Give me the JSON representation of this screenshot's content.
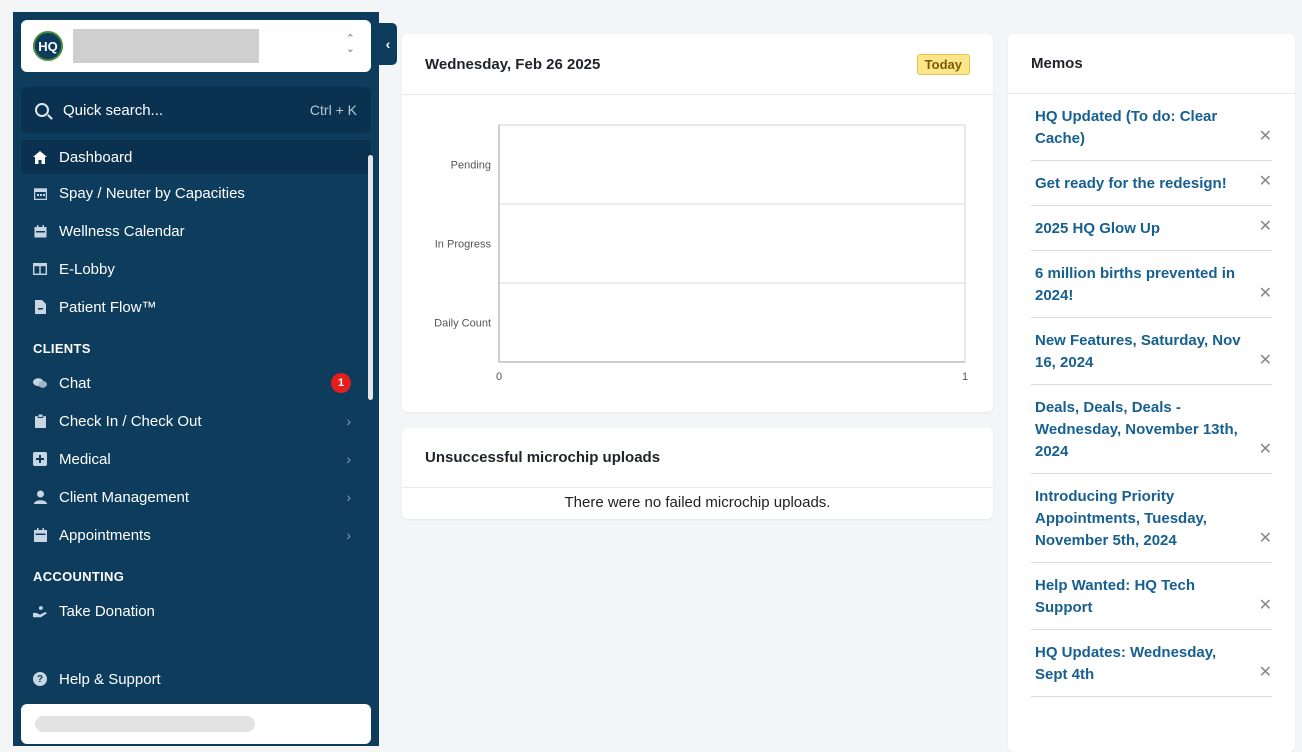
{
  "sidebar": {
    "logo_text": "HQ",
    "search_label": "Quick search...",
    "search_shortcut": "Ctrl + K",
    "items": [
      {
        "label": "Dashboard",
        "icon": "home-icon",
        "active": true
      },
      {
        "label": "Spay / Neuter by Capacities",
        "icon": "calendar-grid-icon"
      },
      {
        "label": "Wellness Calendar",
        "icon": "calendar-icon"
      },
      {
        "label": "E-Lobby",
        "icon": "columns-icon"
      },
      {
        "label": "Patient Flow™",
        "icon": "file-icon"
      }
    ],
    "clients_heading": "CLIENTS",
    "client_items": [
      {
        "label": "Chat",
        "icon": "chat-icon",
        "badge": "1"
      },
      {
        "label": "Check In / Check Out",
        "icon": "clipboard-icon"
      },
      {
        "label": "Medical",
        "icon": "medical-icon"
      },
      {
        "label": "Client Management",
        "icon": "user-icon"
      },
      {
        "label": "Appointments",
        "icon": "calendar-check-icon"
      }
    ],
    "accounting_heading": "ACCOUNTING",
    "accounting_items": [
      {
        "label": "Take Donation",
        "icon": "donation-hand-icon"
      }
    ],
    "help_label": "Help & Support"
  },
  "schedule": {
    "date_title": "Wednesday, Feb 26 2025",
    "today_label": "Today"
  },
  "chart_data": {
    "type": "bar",
    "orientation": "horizontal",
    "categories": [
      "Pending",
      "In Progress",
      "Daily Count"
    ],
    "values": [
      0,
      0,
      0
    ],
    "xlim": [
      0,
      1
    ],
    "xticks": [
      "0",
      "1"
    ],
    "grid": true
  },
  "microchip": {
    "title": "Unsuccessful microchip uploads",
    "empty_text": "There were no failed microchip uploads."
  },
  "memos": {
    "title": "Memos",
    "close_glyph": "✕",
    "items": [
      "HQ Updated (To do: Clear Cache)",
      "Get ready for the redesign!",
      "2025 HQ Glow Up",
      "6 million births prevented in 2024!",
      "New Features, Saturday, Nov 16, 2024",
      "Deals, Deals, Deals - Wednesday, November 13th, 2024",
      "Introducing Priority Appointments, Tuesday, November 5th, 2024",
      "Help Wanted: HQ Tech Support",
      "HQ Updates: Wednesday, Sept 4th"
    ]
  },
  "colors": {
    "sidebar_bg": "#0d3c5c",
    "memo_link": "#17608f",
    "badge": "#e41d1d",
    "today_bg": "#fde68a"
  }
}
